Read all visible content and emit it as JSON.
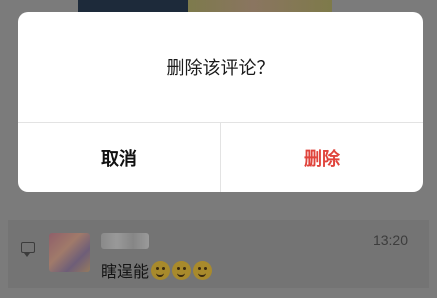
{
  "dialog": {
    "message": "删除该评论？",
    "cancel_label": "取消",
    "confirm_label": "删除",
    "confirm_color": "#e0443c"
  },
  "comment": {
    "time": "13:20",
    "text": "瞎逞能",
    "emoji_icons": [
      "thinking-emoji-icon",
      "thinking-emoji-icon",
      "thinking-emoji-icon"
    ]
  }
}
